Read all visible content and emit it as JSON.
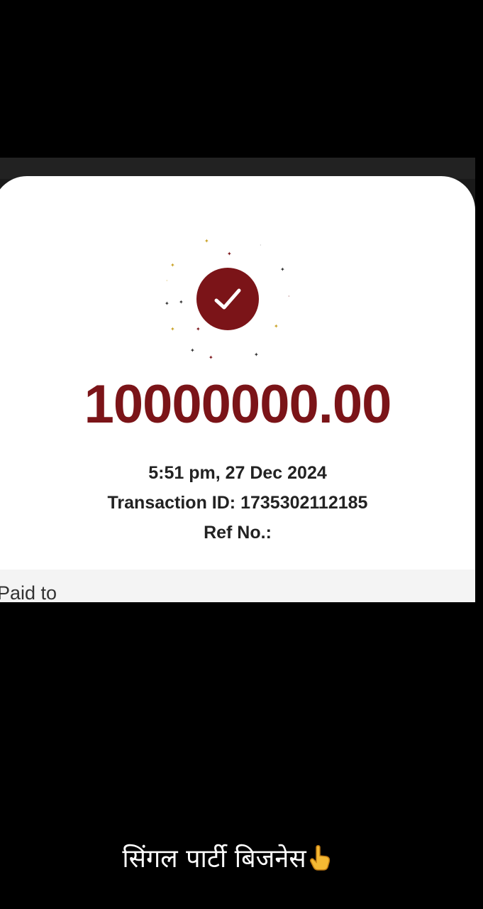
{
  "receipt": {
    "amount": "10000000.00",
    "datetime": "5:51 pm, 27 Dec 2024",
    "transaction_id_label": "Transaction ID:",
    "transaction_id": "1735302112185",
    "ref_label": "Ref No.:",
    "paid_to_label": "Paid to"
  },
  "caption": {
    "text": "सिंगल पार्टी बिजनेस",
    "icon": "pointing-hand-up-icon"
  },
  "icons": {
    "success": "check-icon"
  },
  "colors": {
    "brand": "#7b1418",
    "background": "#000000",
    "card": "#ffffff",
    "text": "#222222"
  }
}
